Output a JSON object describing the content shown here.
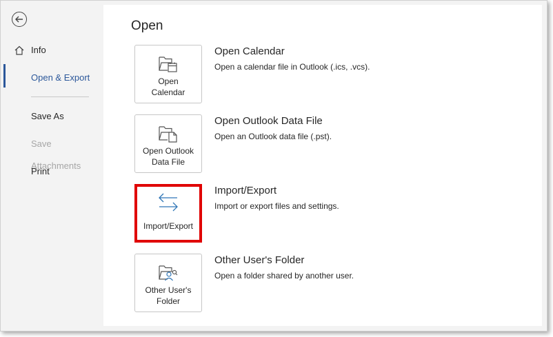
{
  "sidebar": {
    "items": [
      {
        "label": "Info"
      },
      {
        "label": "Open & Export"
      },
      {
        "label": "Save As"
      },
      {
        "label": "Save Attachments"
      },
      {
        "label": "Print"
      }
    ]
  },
  "main": {
    "title": "Open",
    "options": [
      {
        "tile_label": "Open\nCalendar",
        "title": "Open Calendar",
        "description": "Open a calendar file in Outlook (.ics, .vcs)."
      },
      {
        "tile_label": "Open Outlook\nData File",
        "title": "Open Outlook Data File",
        "description": "Open an Outlook data file (.pst)."
      },
      {
        "tile_label": "Import/Export",
        "title": "Import/Export",
        "description": "Import or export files and settings."
      },
      {
        "tile_label": "Other User's\nFolder",
        "title": "Other User's Folder",
        "description": "Open a folder shared by another user."
      }
    ]
  },
  "colors": {
    "accent": "#2b579a",
    "highlight_border": "#e00000",
    "import_icon": "#2e75b6"
  }
}
